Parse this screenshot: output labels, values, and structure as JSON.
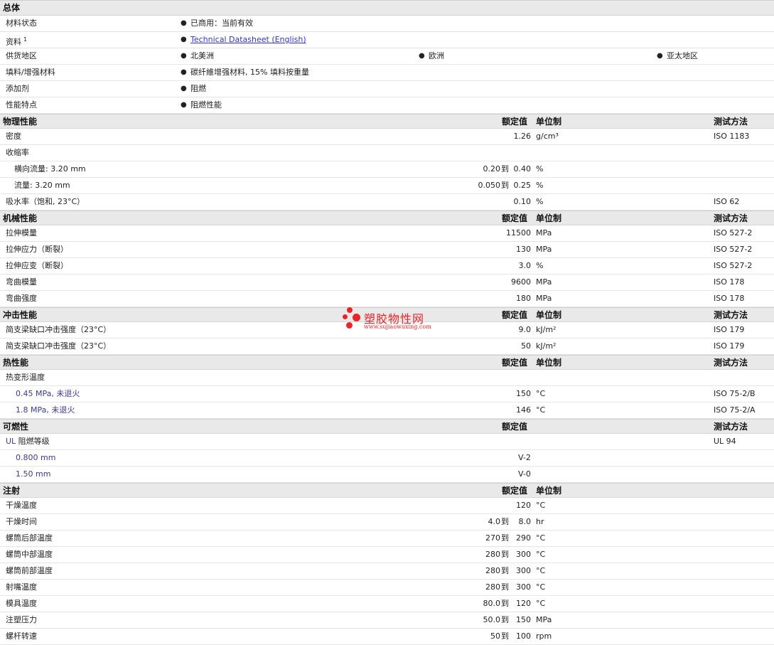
{
  "general": {
    "title": "总体",
    "status": {
      "label": "材料状态",
      "value": "已商用：当前有效"
    },
    "docs": {
      "label": "资料",
      "sup": "1",
      "value": "Technical Datasheet (English)"
    },
    "regions": {
      "label": "供货地区",
      "values": [
        "北美洲",
        "欧洲",
        "亚太地区"
      ]
    },
    "filler": {
      "label": "填料/增强材料",
      "value": "碳纤維增强材料, 15% 填料按重量"
    },
    "additive": {
      "label": "添加剂",
      "value": "阻燃"
    },
    "features": {
      "label": "性能特点",
      "value": "阻燃性能"
    }
  },
  "headers": {
    "nominal": "额定值",
    "unit": "单位制",
    "test": "测试方法",
    "to": "到"
  },
  "physical": {
    "title": "物理性能",
    "density": {
      "label": "密度",
      "value": "1.26",
      "unit": "g/cm³",
      "test": "ISO 1183"
    },
    "shrink": {
      "label": "收缩率"
    },
    "shrink_trans": {
      "label": "横向流量: 3.20 mm",
      "lo": "0.20",
      "hi": "0.40",
      "unit": "%"
    },
    "shrink_flow": {
      "label": "流量: 3.20 mm",
      "lo": "0.050",
      "hi": "0.25",
      "unit": "%"
    },
    "water": {
      "label": "吸水率（饱和, 23°C）",
      "value": "0.10",
      "unit": "%",
      "test": "ISO 62"
    }
  },
  "mechanical": {
    "title": "机械性能",
    "rows": [
      {
        "label": "拉伸模量",
        "value": "11500",
        "unit": "MPa",
        "test": "ISO 527-2"
      },
      {
        "label": "拉伸应力（断裂）",
        "value": "130",
        "unit": "MPa",
        "test": "ISO 527-2"
      },
      {
        "label": "拉伸应变（断裂）",
        "value": "3.0",
        "unit": "%",
        "test": "ISO 527-2"
      },
      {
        "label": "弯曲模量",
        "value": "9600",
        "unit": "MPa",
        "test": "ISO 178"
      },
      {
        "label": "弯曲强度",
        "value": "180",
        "unit": "MPa",
        "test": "ISO 178"
      }
    ]
  },
  "impact": {
    "title": "冲击性能",
    "rows": [
      {
        "label": "简支梁缺口冲击强度（23°C）",
        "value": "9.0",
        "unit": "kJ/m²",
        "test": "ISO 179"
      },
      {
        "label": "简支梁缺口冲击强度（23°C）",
        "value": "50",
        "unit": "kJ/m²",
        "test": "ISO 179"
      }
    ]
  },
  "thermal": {
    "title": "热性能",
    "hdt": {
      "label": "热变形温度"
    },
    "rows": [
      {
        "label": "0.45 MPa, 未退火",
        "value": "150",
        "unit": "°C",
        "test": "ISO 75-2/B"
      },
      {
        "label": "1.8 MPa, 未退火",
        "value": "146",
        "unit": "°C",
        "test": "ISO 75-2/A"
      }
    ]
  },
  "flammability": {
    "title": "可燃性",
    "ul": {
      "label_prefix": "UL",
      "label": " 阻燃等级",
      "test": "UL 94"
    },
    "rows": [
      {
        "label": "0.800 mm",
        "value": "V-2"
      },
      {
        "label": "1.50 mm",
        "value": "V-0"
      }
    ]
  },
  "injection": {
    "title": "注射",
    "single": [
      {
        "label": "干燥温度",
        "value": "120",
        "unit": "°C"
      }
    ],
    "ranges": [
      {
        "label": "干燥时间",
        "lo": "4.0",
        "hi": "8.0",
        "unit": "hr"
      },
      {
        "label": "螺筒后部温度",
        "lo": "270",
        "hi": "290",
        "unit": "°C"
      },
      {
        "label": "螺筒中部温度",
        "lo": "280",
        "hi": "300",
        "unit": "°C"
      },
      {
        "label": "螺筒前部温度",
        "lo": "280",
        "hi": "300",
        "unit": "°C"
      },
      {
        "label": "射嘴温度",
        "lo": "280",
        "hi": "300",
        "unit": "°C"
      },
      {
        "label": "模具温度",
        "lo": "80.0",
        "hi": "120",
        "unit": "°C"
      },
      {
        "label": "注塑压力",
        "lo": "50.0",
        "hi": "150",
        "unit": "MPa"
      },
      {
        "label": "螺杆转速",
        "lo": "50",
        "hi": "100",
        "unit": "rpm"
      }
    ]
  },
  "watermark": {
    "name": "塑胶物性网",
    "url": "www.sujiaowuxing.com"
  }
}
